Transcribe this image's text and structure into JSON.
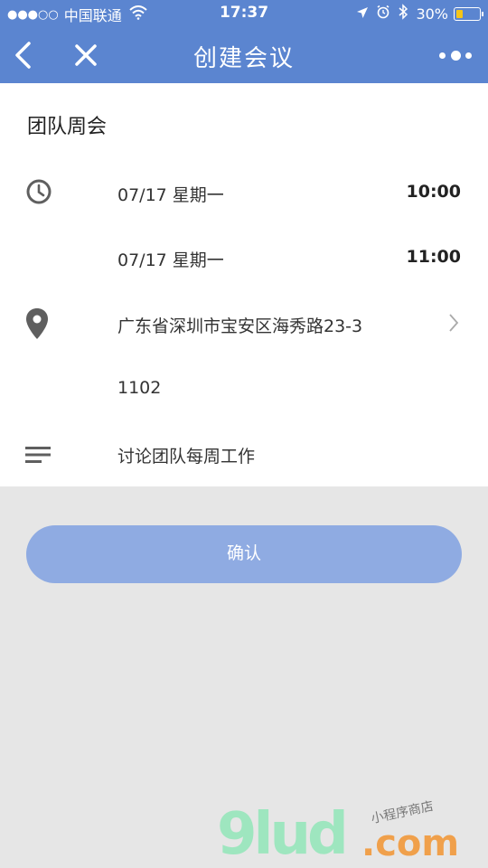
{
  "status_bar": {
    "signal_dots": "●●●○○",
    "carrier": "中国联通",
    "time": "17:37",
    "battery_percent": "30%",
    "battery_level": 0.3
  },
  "nav": {
    "title": "创建会议",
    "back_icon": "chevron-left-icon",
    "close_icon": "close-icon",
    "more_icon": "more-icon"
  },
  "meeting": {
    "title": "团队周会",
    "start": {
      "date": "07/17 星期一",
      "time": "10:00"
    },
    "end": {
      "date": "07/17 星期一",
      "time": "11:00"
    },
    "location_line1": "广东省深圳市宝安区海秀路23-3",
    "location_line2": "1102",
    "description": "讨论团队每周工作"
  },
  "confirm_label": "确认",
  "watermark": {
    "logo": "9lud",
    "suffix": ".com",
    "tagline": "小程序商店"
  },
  "colors": {
    "primary": "#5b85d0",
    "button": "#8fabe2",
    "icon_gray": "#5f5f5f"
  }
}
